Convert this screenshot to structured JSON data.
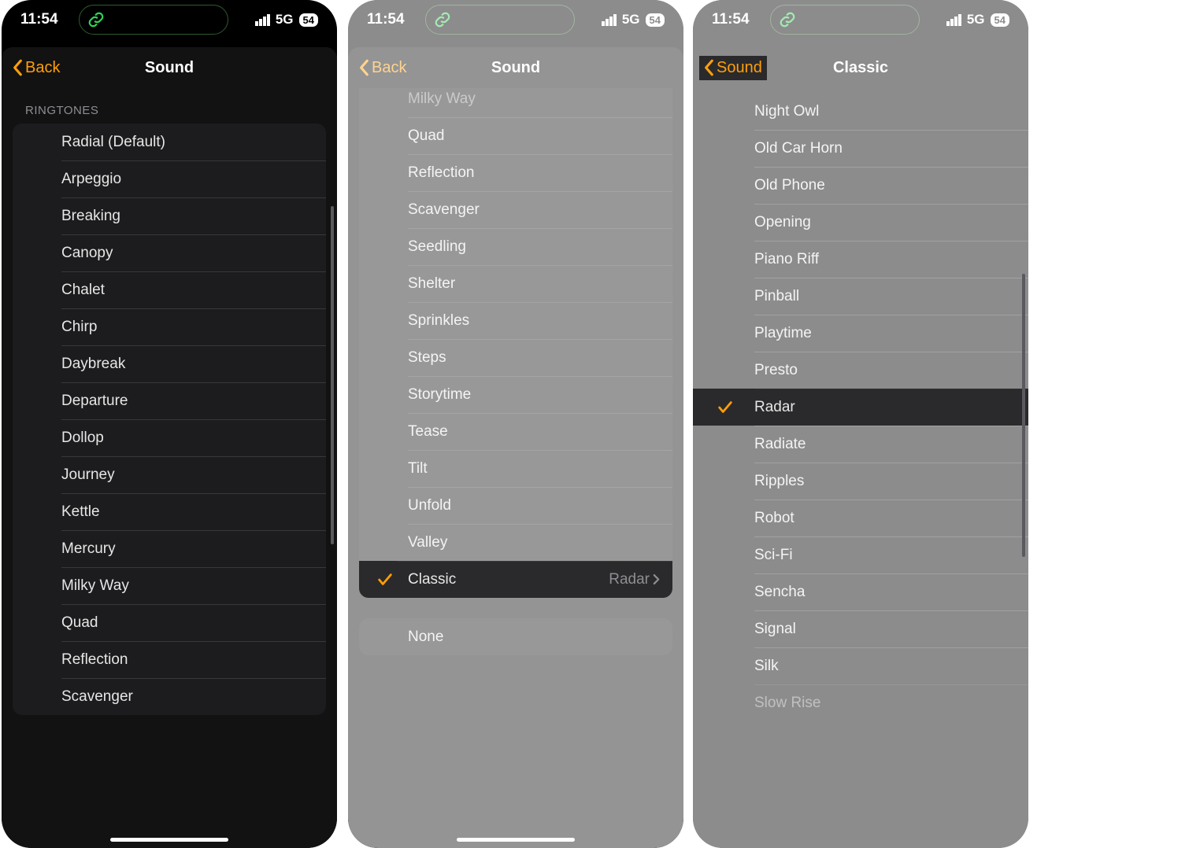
{
  "status": {
    "time": "11:54",
    "network": "5G",
    "battery": "54"
  },
  "screen1": {
    "back_label": "Back",
    "title": "Sound",
    "section": "RINGTONES",
    "items": [
      "Radial (Default)",
      "Arpeggio",
      "Breaking",
      "Canopy",
      "Chalet",
      "Chirp",
      "Daybreak",
      "Departure",
      "Dollop",
      "Journey",
      "Kettle",
      "Mercury",
      "Milky Way",
      "Quad",
      "Reflection",
      "Scavenger"
    ]
  },
  "screen2": {
    "back_label": "Back",
    "title": "Sound",
    "items": [
      "Milky Way",
      "Quad",
      "Reflection",
      "Scavenger",
      "Seedling",
      "Shelter",
      "Sprinkles",
      "Steps",
      "Storytime",
      "Tease",
      "Tilt",
      "Unfold",
      "Valley"
    ],
    "classic": {
      "label": "Classic",
      "detail": "Radar"
    },
    "none": "None"
  },
  "screen3": {
    "back_label": "Sound",
    "title": "Classic",
    "items": [
      "Night Owl",
      "Old Car Horn",
      "Old Phone",
      "Opening",
      "Piano Riff",
      "Pinball",
      "Playtime",
      "Presto",
      "Radar",
      "Radiate",
      "Ripples",
      "Robot",
      "Sci-Fi",
      "Sencha",
      "Signal",
      "Silk",
      "Slow Rise"
    ],
    "selected": "Radar"
  }
}
